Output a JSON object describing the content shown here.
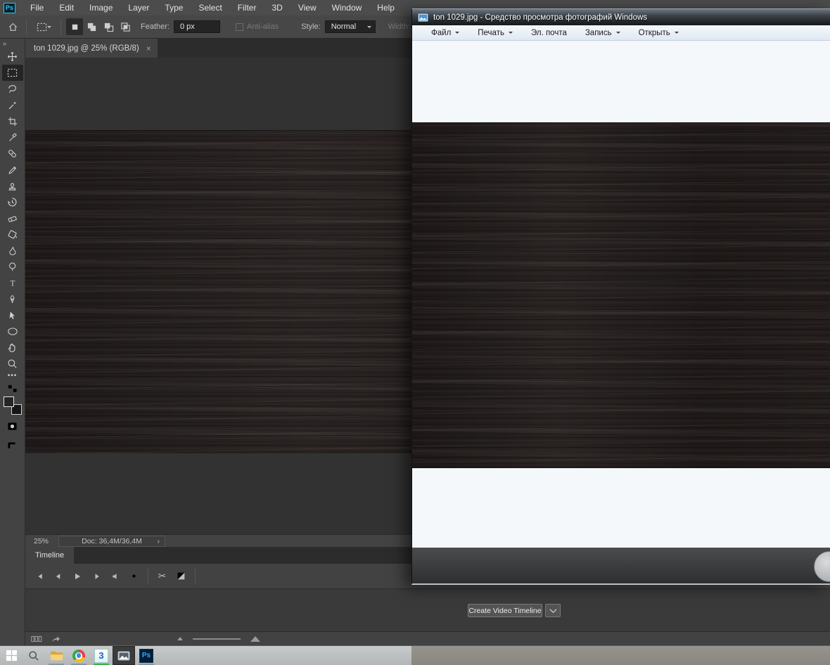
{
  "photoshop": {
    "logo_label": "Ps",
    "menu": [
      "File",
      "Edit",
      "Image",
      "Layer",
      "Type",
      "Select",
      "Filter",
      "3D",
      "View",
      "Window",
      "Help"
    ],
    "options_bar": {
      "feather_label": "Feather:",
      "feather_value": "0 px",
      "anti_alias_label": "Anti-alias",
      "style_label": "Style:",
      "style_value": "Normal",
      "width_label": "Width:"
    },
    "document_tab": {
      "title": "ton 1029.jpg @ 25% (RGB/8)",
      "close": "×"
    },
    "tools": [
      "move-tool",
      "rectangular-marquee-tool",
      "lasso-tool",
      "magic-wand-tool",
      "crop-tool",
      "eyedropper-tool",
      "spot-healing-brush-tool",
      "brush-tool",
      "clone-stamp-tool",
      "history-brush-tool",
      "eraser-tool",
      "gradient-tool",
      "smudge-tool",
      "dodge-tool",
      "type-tool",
      "pen-tool",
      "path-selection-tool",
      "ellipse-tool",
      "hand-tool",
      "zoom-tool"
    ],
    "status_bar": {
      "zoom_level": "25%",
      "doc_size": "Doc: 36,4M/36,4M",
      "chevron": "›"
    },
    "timeline": {
      "tab_label": "Timeline",
      "controls": [
        "first-frame",
        "previous-frame",
        "play",
        "next-frame",
        "audio",
        "settings",
        "split-at-playhead",
        "transition"
      ],
      "create_button_label": "Create Video Timeline"
    },
    "colors": {
      "foreground_swatch": "#262626",
      "background_swatch": "#161616",
      "accent": "#31a8ff"
    }
  },
  "photo_viewer": {
    "title": "ton 1029.jpg - Средство просмотра фотографий Windows",
    "menu": [
      {
        "label": "Файл"
      },
      {
        "label": "Печать"
      },
      {
        "label": "Эл. почта"
      },
      {
        "label": "Запись"
      },
      {
        "label": "Открыть"
      }
    ]
  },
  "taskbar": {
    "items": [
      "start",
      "search",
      "file-explorer",
      "chrome",
      "app-3",
      "windows-photo-viewer",
      "photoshop"
    ],
    "app3_label": "3",
    "photoshop_label": "Ps",
    "active_item": "windows-photo-viewer"
  }
}
